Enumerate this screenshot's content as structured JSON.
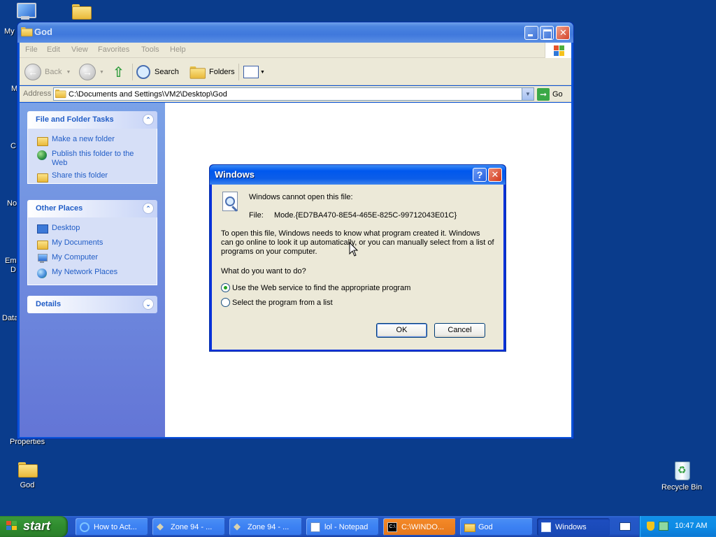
{
  "desktop": {
    "icons": [
      {
        "label": "God"
      },
      {
        "label": "Recycle Bin"
      }
    ],
    "partial_labels": [
      "My",
      "M",
      "C",
      "No",
      "Em",
      "D",
      "Data",
      "Properties"
    ]
  },
  "explorer": {
    "title": "God",
    "menu": [
      "File",
      "Edit",
      "View",
      "Favorites",
      "Tools",
      "Help"
    ],
    "toolbar": {
      "back": "Back",
      "search": "Search",
      "folders": "Folders"
    },
    "address": {
      "label": "Address",
      "value": "C:\\Documents and Settings\\VM2\\Desktop\\God",
      "go": "Go"
    },
    "tasks": {
      "file_folder": {
        "title": "File and Folder Tasks",
        "items": [
          "Make a new folder",
          "Publish this folder to the Web",
          "Share this folder"
        ]
      },
      "other_places": {
        "title": "Other Places",
        "items": [
          "Desktop",
          "My Documents",
          "My Computer",
          "My Network Places"
        ]
      },
      "details": {
        "title": "Details"
      }
    }
  },
  "dialog": {
    "title": "Windows",
    "message": "Windows cannot open this file:",
    "file_label": "File:",
    "file_name": "Mode.{ED7BA470-8E54-465E-825C-99712043E01C}",
    "explanation_lines": [
      "To open this file, Windows needs to know what program created it.  Windows",
      "can go online to look it up automatically, or you can manually select from a list of",
      "programs on your computer."
    ],
    "question": "What do you want to do?",
    "options": [
      {
        "label": "Use the Web service to find the appropriate program",
        "selected": true
      },
      {
        "label": "Select the program from a list",
        "selected": false
      }
    ],
    "ok": "OK",
    "cancel": "Cancel"
  },
  "taskbar": {
    "start": "start",
    "tasks": [
      {
        "label": "How to Act...",
        "icon": "ie-icon"
      },
      {
        "label": "Zone 94 - ...",
        "icon": "zone-icon"
      },
      {
        "label": "Zone 94 - ...",
        "icon": "zone-icon"
      },
      {
        "label": "lol - Notepad",
        "icon": "notepad-icon"
      },
      {
        "label": "C:\\WINDO...",
        "icon": "cmd-icon"
      },
      {
        "label": "God",
        "icon": "folder-icon"
      },
      {
        "label": "Windows",
        "icon": "window-icon"
      }
    ],
    "clock": "10:47 AM"
  },
  "colors": {
    "desktop": "#0a3c8c",
    "titlebar_active": "#0058ee",
    "taskbar": "#2155c4",
    "start_green": "#2f8c2e",
    "link_blue": "#215dc6"
  }
}
